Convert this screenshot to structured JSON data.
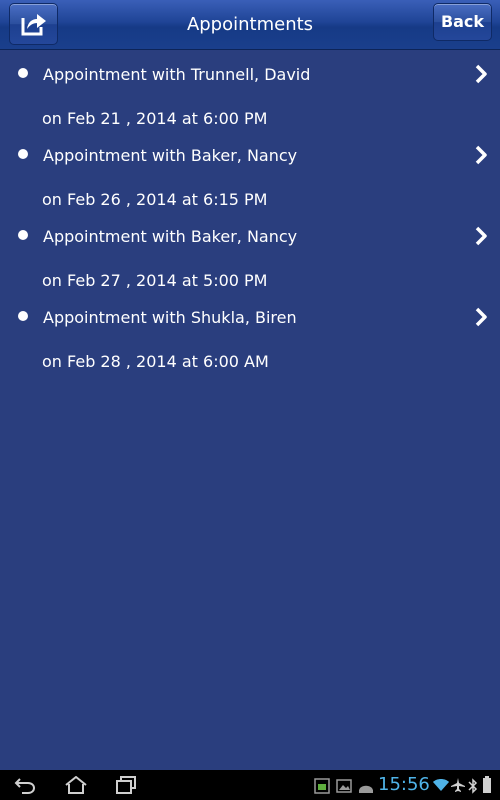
{
  "header": {
    "title": "Appointments",
    "back_label": "Back",
    "share_icon": "share-icon"
  },
  "appointments": [
    {
      "title": "Appointment with Trunnell, David",
      "datetime": "on Feb 21 , 2014 at 6:00 PM"
    },
    {
      "title": "Appointment with Baker, Nancy",
      "datetime": "on Feb 26 , 2014 at 6:15 PM"
    },
    {
      "title": "Appointment with Baker, Nancy",
      "datetime": "on Feb 27 , 2014 at 5:00 PM"
    },
    {
      "title": "Appointment with Shukla, Biren",
      "datetime": "on Feb 28 , 2014 at 6:00 AM"
    }
  ],
  "system_bar": {
    "time": "15:56",
    "nav_icons": [
      "back-icon",
      "home-icon",
      "recent-apps-icon"
    ],
    "status_icons": [
      "screenshot-icon",
      "gallery-icon",
      "android-icon",
      "wifi-icon",
      "airplane-icon",
      "bluetooth-icon",
      "battery-icon"
    ]
  },
  "colors": {
    "background": "#2a3e7e",
    "header": "#1f4496",
    "clock": "#4fb3e8"
  }
}
